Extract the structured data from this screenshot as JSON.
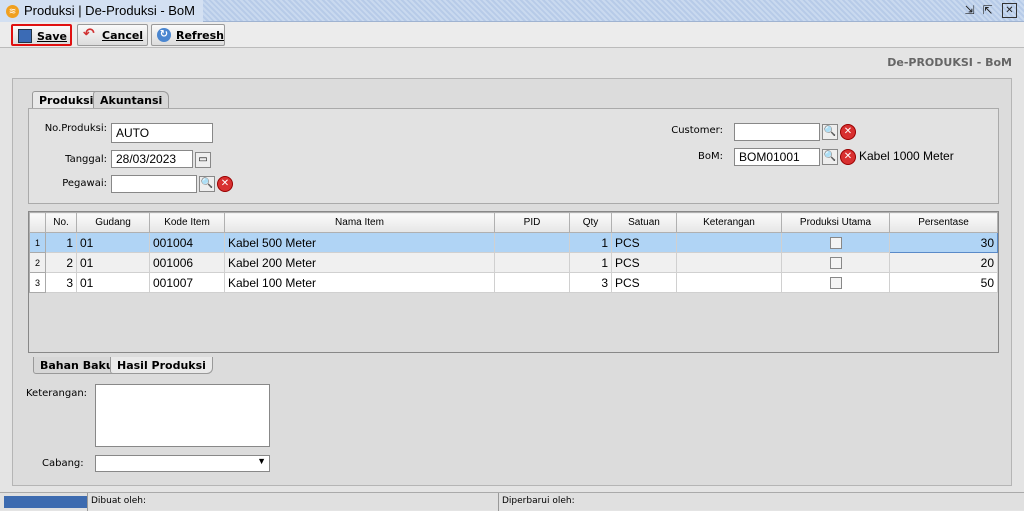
{
  "window": {
    "title": "Produksi | De-Produksi - BoM"
  },
  "toolbar": {
    "save": "Save",
    "cancel": "Cancel",
    "refresh": "Refresh"
  },
  "header": "De-PRODUKSI - BoM",
  "tabs": [
    "Produksi",
    "Akuntansi"
  ],
  "form": {
    "no_produksi_label": "No.Produksi:",
    "no_produksi": "AUTO",
    "tanggal_label": "Tanggal:",
    "tanggal": "28/03/2023",
    "pegawai_label": "Pegawai:",
    "pegawai": "",
    "customer_label": "Customer:",
    "customer": "",
    "bom_label": "BoM:",
    "bom": "BOM01001",
    "bom_name": "Kabel 1000 Meter"
  },
  "grid": {
    "columns": [
      "No.",
      "Gudang",
      "Kode Item",
      "Nama Item",
      "PID",
      "Qty",
      "Satuan",
      "Keterangan",
      "Produksi Utama",
      "Persentase"
    ],
    "rows": [
      {
        "rn": "1",
        "no": "1",
        "gudang": "01",
        "kode": "001004",
        "nama": "Kabel 500 Meter",
        "pid": "",
        "qty": "1",
        "satuan": "PCS",
        "ket": "",
        "utama": false,
        "persen": "30"
      },
      {
        "rn": "2",
        "no": "2",
        "gudang": "01",
        "kode": "001006",
        "nama": "Kabel 200 Meter",
        "pid": "",
        "qty": "1",
        "satuan": "PCS",
        "ket": "",
        "utama": false,
        "persen": "20"
      },
      {
        "rn": "3",
        "no": "3",
        "gudang": "01",
        "kode": "001007",
        "nama": "Kabel 100 Meter",
        "pid": "",
        "qty": "3",
        "satuan": "PCS",
        "ket": "",
        "utama": false,
        "persen": "50"
      }
    ]
  },
  "bottom_tabs": [
    "Bahan Baku",
    "Hasil Produksi"
  ],
  "bottom": {
    "keterangan_label": "Keterangan:",
    "keterangan": "",
    "cabang_label": "Cabang:",
    "cabang": ""
  },
  "status": {
    "dibuat": "Dibuat oleh:",
    "diperbarui": "Diperbarui oleh:"
  }
}
